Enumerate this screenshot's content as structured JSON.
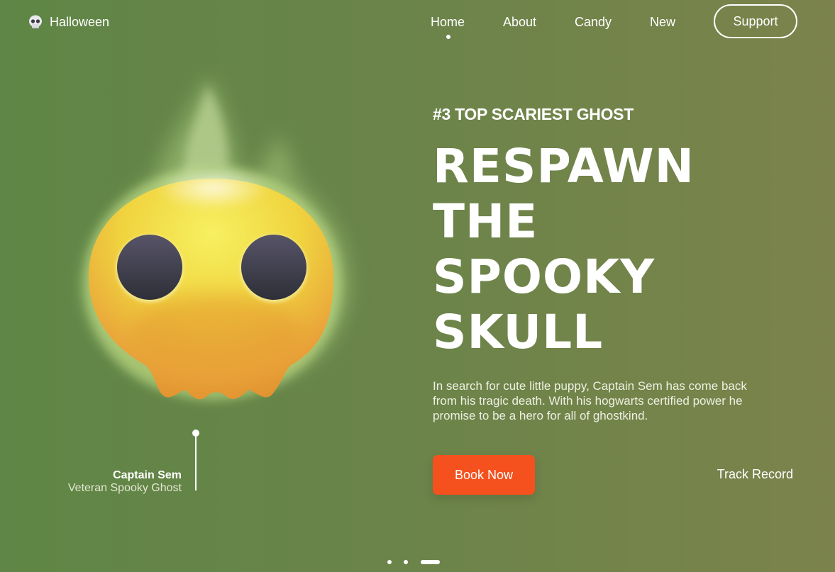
{
  "header": {
    "logo_text": "Halloween",
    "logo_icon": "skull-icon",
    "nav": [
      {
        "label": "Home",
        "active": true
      },
      {
        "label": "About",
        "active": false
      },
      {
        "label": "Candy",
        "active": false
      },
      {
        "label": "New",
        "active": false
      }
    ],
    "support_label": "Support"
  },
  "hero": {
    "kicker": "#3 TOP SCARIEST GHOST",
    "headline": [
      "RESPAWN",
      "THE",
      "SPOOKY",
      "SKULL"
    ],
    "description": "In search for cute little puppy, Captain Sem has come back from his tragic death. With his hogwarts certified power he promise to be a hero for all of ghostkind.",
    "book_label": "Book Now",
    "track_label": "Track Record"
  },
  "character": {
    "name": "Captain Sem",
    "role": "Veteran Spooky Ghost"
  },
  "pager": {
    "count": 3,
    "active_index": 2
  },
  "colors": {
    "background_left": "#5f8646",
    "background_right": "#7b834b",
    "accent": "#f4511e",
    "skull_yellow": "#f5e94a",
    "skull_orange": "#e8992f",
    "eye_dark": "#3d3b4a"
  }
}
